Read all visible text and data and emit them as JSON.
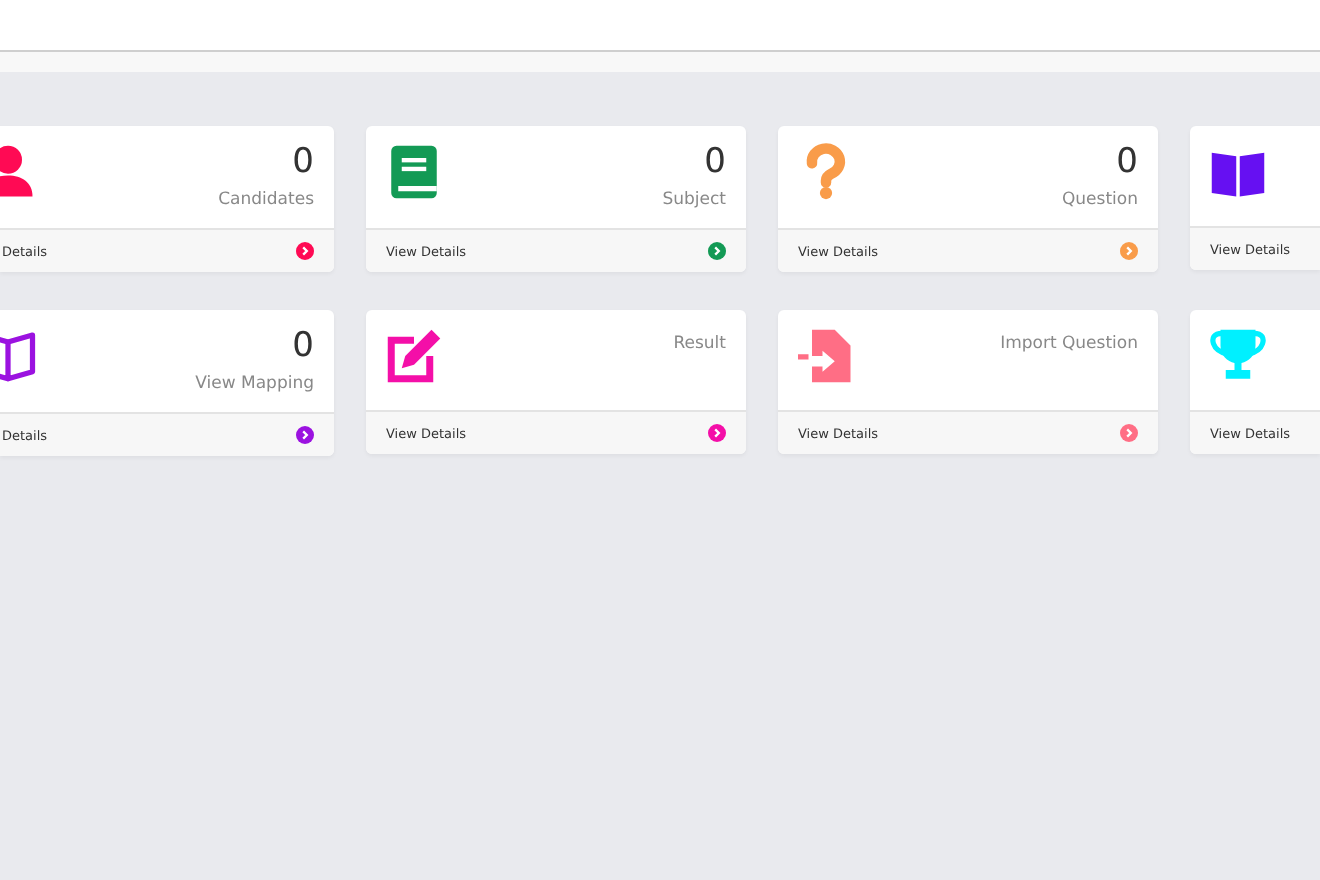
{
  "cards": [
    {
      "kind": "person",
      "color": "#ff0a54",
      "count": "0",
      "label": "Candidates",
      "link": "Details"
    },
    {
      "kind": "book",
      "color": "#139a55",
      "count": "0",
      "label": "Subject",
      "link": "View Details"
    },
    {
      "kind": "question",
      "color": "#f99c4a",
      "count": "0",
      "label": "Question",
      "link": "View Details"
    },
    {
      "kind": "open-book",
      "color": "#6610f2",
      "link": "View Details"
    },
    {
      "kind": "map",
      "color": "#9b12e0",
      "count": "0",
      "label": "View Mapping",
      "link": "Details"
    },
    {
      "kind": "edit",
      "color": "#f40fa8",
      "label": "Result",
      "link": "View Details"
    },
    {
      "kind": "import",
      "color": "#ff6e85",
      "label": "Import Question",
      "link": "View Details"
    },
    {
      "kind": "trophy",
      "color": "#00f0ff",
      "link": "View Details"
    }
  ]
}
